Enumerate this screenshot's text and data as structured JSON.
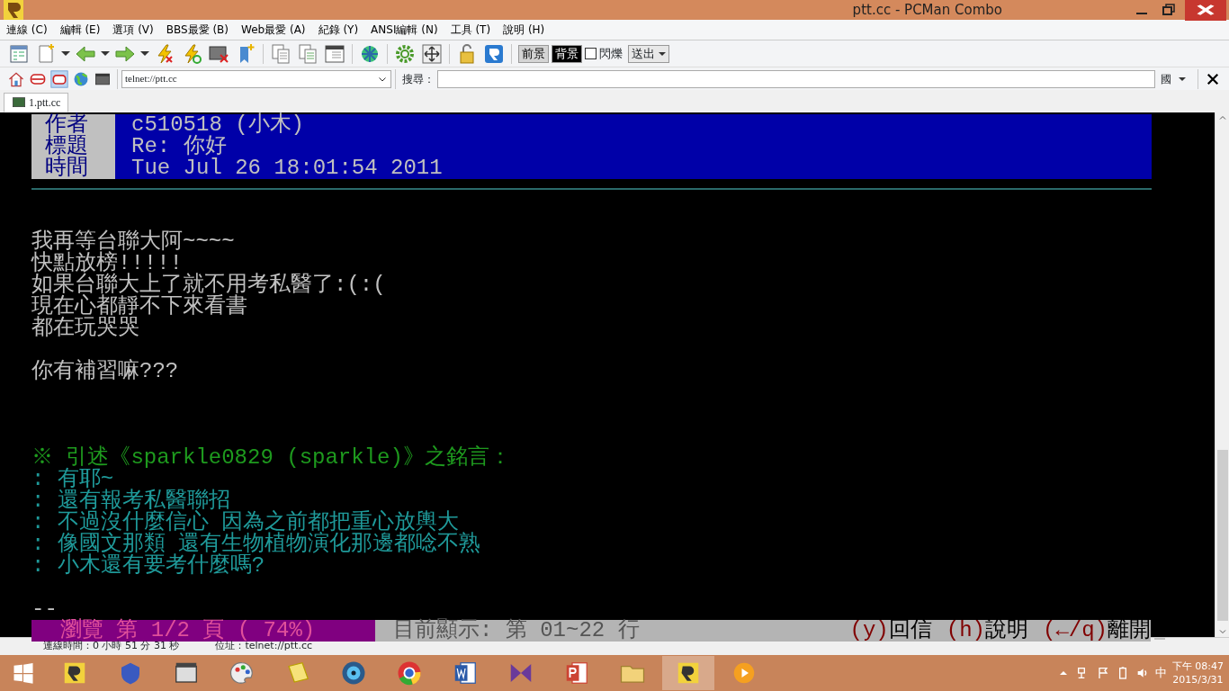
{
  "window": {
    "title": "ptt.cc - PCMan Combo"
  },
  "menu": [
    "連線 (C)",
    "編輯 (E)",
    "選項 (V)",
    "BBS最愛 (B)",
    "Web最愛 (A)",
    "紀錄 (Y)",
    "ANSI編輯 (N)",
    "工具 (T)",
    "說明 (H)"
  ],
  "color_bar": {
    "foreground": {
      "label": "前景",
      "selected": false
    },
    "background": {
      "label": "背景",
      "selected": true
    },
    "blink": {
      "label": "閃爍",
      "checked": false
    },
    "send": {
      "label": "送出"
    }
  },
  "address": {
    "value": "telnet://ptt.cc"
  },
  "search": {
    "label": "搜尋：",
    "ime": "國"
  },
  "tabs": [
    {
      "label": "1.ptt.cc",
      "selected": true
    }
  ],
  "header": [
    {
      "label": "作者",
      "value": "c510518 (小木)"
    },
    {
      "label": "標題",
      "value": "Re: 你好"
    },
    {
      "label": "時間",
      "value": "Tue Jul 26 18:01:54 2011"
    }
  ],
  "lines": [
    {
      "kind": "rule"
    },
    {
      "kind": "blank"
    },
    {
      "kind": "text",
      "text": "我再等台聯大阿~~~~",
      "color": "#c0c0c0"
    },
    {
      "kind": "text",
      "text": "快點放榜!!!!!",
      "color": "#c0c0c0"
    },
    {
      "kind": "text",
      "text": "如果台聯大上了就不用考私醫了:(:(",
      "color": "#c0c0c0"
    },
    {
      "kind": "text",
      "text": "現在心都靜不下來看書",
      "color": "#c0c0c0"
    },
    {
      "kind": "text",
      "text": "都在玩哭哭",
      "color": "#c0c0c0"
    },
    {
      "kind": "blank"
    },
    {
      "kind": "text",
      "text": "你有補習嘛???",
      "color": "#c0c0c0"
    },
    {
      "kind": "blank"
    },
    {
      "kind": "blank"
    },
    {
      "kind": "blank"
    },
    {
      "kind": "text",
      "text": "※ 引述《sparkle0829 (sparkle)》之銘言：",
      "color": "#1e9a1e"
    },
    {
      "kind": "text",
      "text": ": 有耶~",
      "color": "#1f9a9a"
    },
    {
      "kind": "text",
      "text": ": 還有報考私醫聯招",
      "color": "#1f9a9a"
    },
    {
      "kind": "text",
      "text": ": 不過沒什麼信心 因為之前都把重心放輿大",
      "color": "#1f9a9a"
    },
    {
      "kind": "text",
      "text": ": 像國文那類 還有生物植物演化那邊都唸不熟",
      "color": "#1f9a9a"
    },
    {
      "kind": "text",
      "text": ": 小木還有要考什麼嗎?",
      "color": "#1f9a9a"
    },
    {
      "kind": "blank"
    },
    {
      "kind": "text",
      "text": "--",
      "color": "#c0c0c0"
    }
  ],
  "pager": {
    "position": "瀏覽 第 1/2 頁 ( 74%)",
    "range": "目前顯示: 第 01~22 行",
    "hints": [
      {
        "key": "(y)",
        "action": "回信"
      },
      {
        "key": "(h)",
        "action": "說明"
      },
      {
        "key": "(←/q)",
        "action": "離開"
      }
    ]
  },
  "status_bar": {
    "connected": "連線時間：0 小時 51 分 31 秒",
    "address": "位址：telnet://ptt.cc"
  },
  "taskbar": {
    "ime": "中",
    "time": "下午 08:47",
    "date": "2015/3/31"
  }
}
